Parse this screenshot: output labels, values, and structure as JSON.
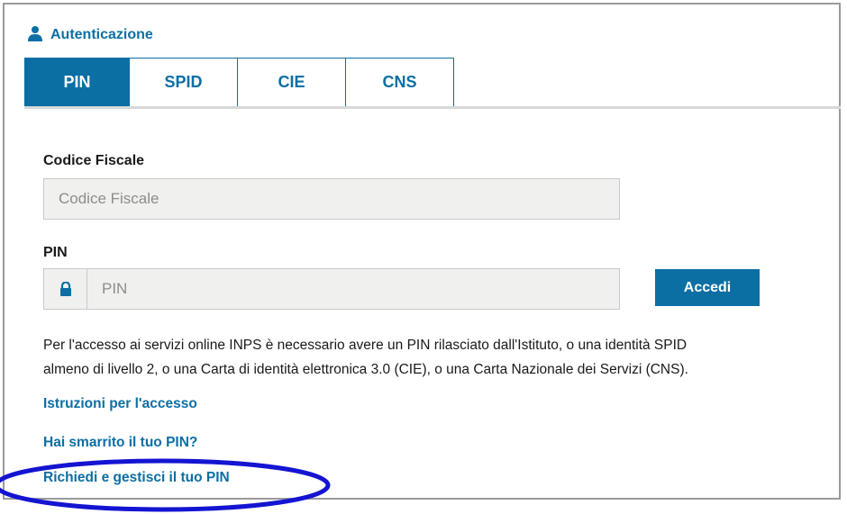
{
  "header": {
    "title": "Autenticazione",
    "icon": "user-icon"
  },
  "tabs": [
    {
      "label": "PIN",
      "active": true
    },
    {
      "label": "SPID",
      "active": false
    },
    {
      "label": "CIE",
      "active": false
    },
    {
      "label": "CNS",
      "active": false
    }
  ],
  "form": {
    "codice_fiscale": {
      "label": "Codice Fiscale",
      "placeholder": "Codice Fiscale",
      "value": ""
    },
    "pin": {
      "label": "PIN",
      "placeholder": "PIN",
      "value": "",
      "icon": "lock-icon"
    },
    "submit_label": "Accedi"
  },
  "info": {
    "line1": "Per l'accesso ai servizi online INPS è necessario avere un PIN rilasciato dall'Istituto, o una identità SPID",
    "line2": "almeno di livello 2, o una Carta di identità elettronica 3.0 (CIE), o una Carta Nazionale dei Servizi (CNS)."
  },
  "links": {
    "istruzioni": "Istruzioni per l'accesso",
    "smarrito": "Hai smarrito il tuo PIN?",
    "richiedi": "Richiedi e gestisci il tuo PIN"
  },
  "colors": {
    "accent": "#0b6fa4",
    "input_bg": "#f0f0ef",
    "highlight": "#1414d2"
  }
}
